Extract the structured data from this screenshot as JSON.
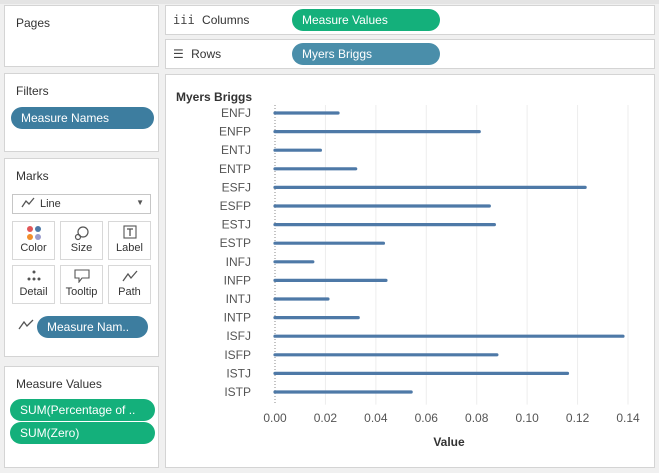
{
  "pages": {
    "title": "Pages"
  },
  "filters": {
    "title": "Filters",
    "pill": "Measure Names"
  },
  "marks": {
    "title": "Marks",
    "mark_type": "Line",
    "buttons": {
      "color": "Color",
      "size": "Size",
      "label": "Label",
      "detail": "Detail",
      "tooltip": "Tooltip",
      "path": "Path"
    },
    "path_pill": "Measure Nam.."
  },
  "measure_values": {
    "title": "Measure Values",
    "items": [
      "SUM(Percentage of ..",
      "SUM(Zero)"
    ]
  },
  "shelves": {
    "columns_label": "Columns",
    "columns_pill": "Measure Values",
    "rows_label": "Rows",
    "rows_pill": "Myers Briggs"
  },
  "colors": {
    "green_pill": "#14b07b",
    "blue_pill": "#4a8eaa",
    "line": "#4e79a7"
  },
  "chart_data": {
    "type": "bar",
    "row_header": "Myers Briggs",
    "xlabel": "Value",
    "xlim": [
      0,
      0.14
    ],
    "xticks": [
      "0.00",
      "0.02",
      "0.04",
      "0.06",
      "0.08",
      "0.10",
      "0.12",
      "0.14"
    ],
    "categories": [
      "ENFJ",
      "ENFP",
      "ENTJ",
      "ENTP",
      "ESFJ",
      "ESFP",
      "ESTJ",
      "ESTP",
      "INFJ",
      "INFP",
      "INTJ",
      "INTP",
      "ISFJ",
      "ISFP",
      "ISTJ",
      "ISTP"
    ],
    "values": [
      0.025,
      0.081,
      0.018,
      0.032,
      0.123,
      0.085,
      0.087,
      0.043,
      0.015,
      0.044,
      0.021,
      0.033,
      0.138,
      0.088,
      0.116,
      0.054
    ]
  }
}
